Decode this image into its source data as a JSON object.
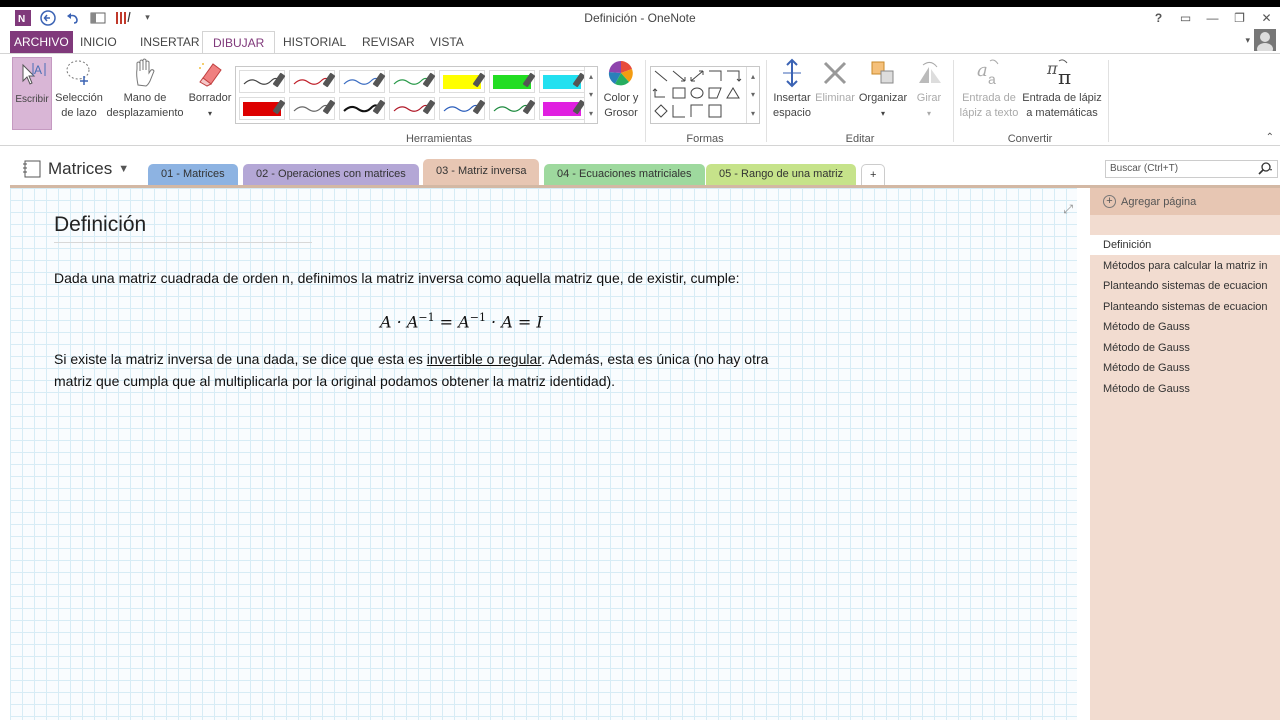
{
  "window": {
    "title": "Definición - OneNote",
    "controls": [
      "?",
      "▭",
      "—",
      "❐",
      "✕"
    ]
  },
  "ribbon_tabs": [
    "ARCHIVO",
    "INICIO",
    "INSERTAR",
    "DIBUJAR",
    "HISTORIAL",
    "REVISAR",
    "VISTA"
  ],
  "active_tab": "DIBUJAR",
  "ribbon": {
    "tools": {
      "escribir": "Escribir",
      "seleccion": [
        "Selección",
        "de lazo"
      ],
      "mano": [
        "Mano de",
        "desplazamiento"
      ],
      "borrador": "Borrador",
      "color": [
        "Color y",
        "Grosor"
      ],
      "group_label": "Herramientas"
    },
    "pens": [
      {
        "color": "#444444",
        "highlight": false
      },
      {
        "color": "#c0202a",
        "highlight": false
      },
      {
        "color": "#3d6ec2",
        "highlight": false
      },
      {
        "color": "#2a9a4a",
        "highlight": false
      },
      {
        "color": "#ffff00",
        "highlight": true
      },
      {
        "color": "#22dd22",
        "highlight": true
      },
      {
        "color": "#22e0f0",
        "highlight": true
      },
      {
        "color": "#dd0000",
        "highlight": true
      },
      {
        "color": "#666666",
        "highlight": false
      },
      {
        "color": "#111111",
        "highlight": false
      },
      {
        "color": "#b01828",
        "highlight": false
      },
      {
        "color": "#2a5dbb",
        "highlight": false
      },
      {
        "color": "#1d8a3e",
        "highlight": false
      },
      {
        "color": "#e020e0",
        "highlight": true
      }
    ],
    "shapes_label": "Formas",
    "editar": {
      "insertar": [
        "Insertar",
        "espacio"
      ],
      "eliminar": "Eliminar",
      "organizar": "Organizar",
      "girar": "Girar",
      "group_label": "Editar"
    },
    "convertir": {
      "texto": [
        "Entrada de",
        "lápiz a texto"
      ],
      "mates": [
        "Entrada de lápiz",
        "a matemáticas"
      ],
      "group_label": "Convertir"
    }
  },
  "notebook": {
    "name": "Matrices",
    "sections": [
      {
        "label": "01 - Matrices",
        "color": "#8db3e2"
      },
      {
        "label": "02 - Operaciones con matrices",
        "color": "#b4a7d6"
      },
      {
        "label": "03 - Matriz inversa",
        "color": "#e7c6b3"
      },
      {
        "label": "04 - Ecuaciones matriciales",
        "color": "#9ed99e"
      },
      {
        "label": "05 - Rango de una matriz",
        "color": "#c6e38a"
      },
      {
        "label": "+",
        "color": "#ffffff"
      }
    ],
    "active_section": 2,
    "search_placeholder": "Buscar (Ctrl+T)"
  },
  "page": {
    "title": "Definición",
    "p1": "Dada una matriz cuadrada de orden n, definimos la matriz inversa como aquella matriz que, de existir, cumple:",
    "formula": {
      "a": "A · A",
      "exp1": "−1",
      "b": " = A",
      "exp2": "−1",
      "c": " · A = I"
    },
    "p2_start": "Si existe la matriz inversa de una dada, se dice que esta es ",
    "p2_link": "invertible o regular",
    "p2_end": ". Además, esta es única (no hay otra",
    "p2_line2": "matriz que cumpla que al multiplicarla por la original podamos obtener la matriz identidad)."
  },
  "pages_pane": {
    "add_label": "Agregar página",
    "items": [
      "Definición",
      "Métodos para calcular la matriz in",
      "Planteando sistemas de ecuacion",
      "Planteando sistemas de ecuacion",
      "Método de Gauss",
      "Método de Gauss",
      "Método de Gauss",
      "Método de Gauss"
    ]
  }
}
